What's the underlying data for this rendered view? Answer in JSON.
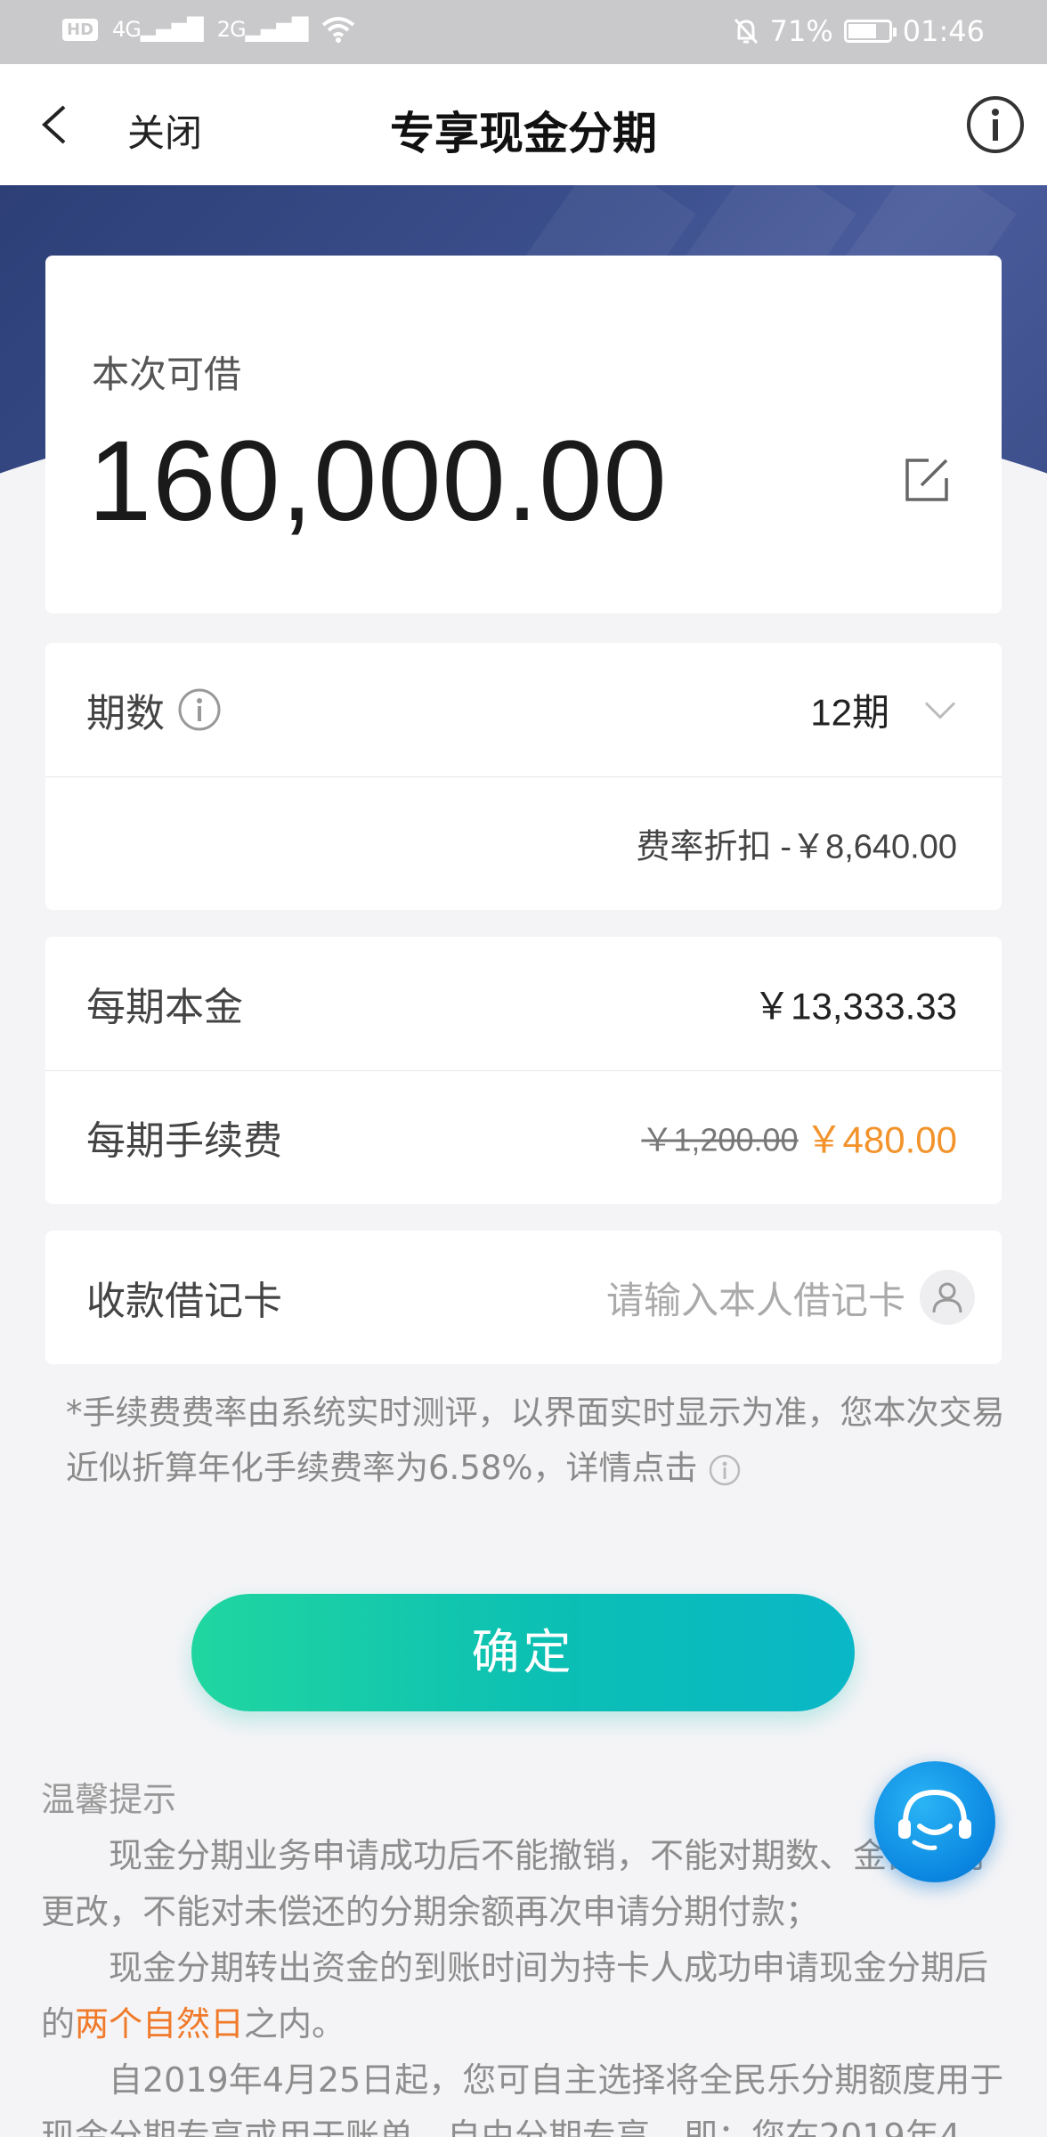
{
  "status_bar": {
    "hd": "HD",
    "net1": "4G",
    "net2": "2G",
    "battery_percent": "71%",
    "time": "01:46",
    "battery_level": 0.71
  },
  "nav": {
    "close_label": "关闭",
    "title": "专享现金分期"
  },
  "amount": {
    "label": "本次可借",
    "value": "160,000.00"
  },
  "period": {
    "label": "期数",
    "value": "12期",
    "discount_label": "费率折扣",
    "discount_value": "-￥8,640.00"
  },
  "fees": {
    "principal_label": "每期本金",
    "principal_value": "￥13,333.33",
    "fee_label": "每期手续费",
    "fee_original": "￥1,200.00",
    "fee_value": "￥480.00"
  },
  "debit": {
    "label": "收款借记卡",
    "placeholder": "请输入本人借记卡"
  },
  "note": {
    "text": "*手续费费率由系统实时测评，以界面实时显示为准，您本次交易近似折算年化手续费率为6.58%，详情点击"
  },
  "confirm_label": "确定",
  "tips": {
    "title": "温馨提示",
    "p1": "现金分期业务申请成功后不能撤销，不能对期数、金额进行更改，不能对未偿还的分期余额再次申请分期付款；",
    "p2_a": "现金分期转出资金的到账时间为持卡人成功申请现金分期后的",
    "p2_hl": "两个自然日",
    "p2_b": "之内。",
    "p3": "自2019年4月25日起，您可自主选择将全民乐分期额度用于现金分期专享或用于账单、自由分期专享，即：您在2019年4"
  },
  "colors": {
    "accent": "#0bbfb4",
    "highlight": "#f2932b",
    "hero": "#3b4e8c"
  }
}
